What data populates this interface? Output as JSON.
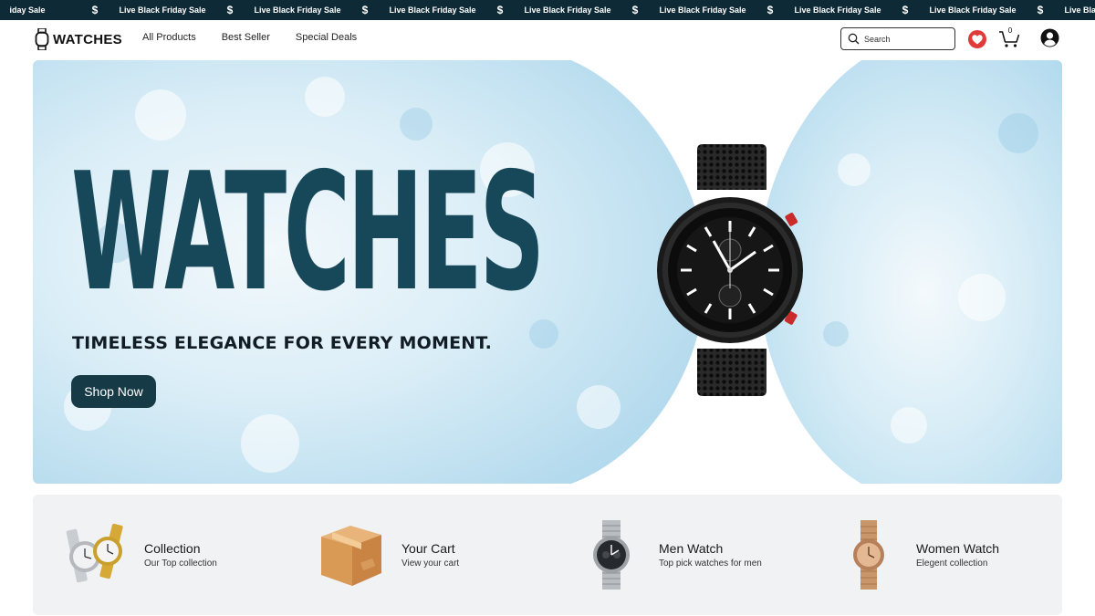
{
  "ticker": {
    "items": [
      "iday Sale",
      "Live Black Friday Sale",
      "Live Black Friday Sale",
      "Live Black Friday Sale",
      "Live Black Friday Sale",
      "Live Black Friday Sale",
      "Live Black Friday Sale",
      "Live Black Friday Sale",
      "Live Black Friday Sale"
    ],
    "separator": "$"
  },
  "header": {
    "logo_text": "WATCHES",
    "nav": [
      "All Products",
      "Best Seller",
      "Special Deals"
    ],
    "search_placeholder": "Search",
    "cart_count": "0",
    "icons": [
      "watch-logo-icon",
      "search-icon",
      "heart-icon",
      "cart-icon",
      "account-icon"
    ]
  },
  "hero": {
    "title": "WATCHES",
    "tagline": "TIMELESS ELEGANCE FOR EVERY MOMENT.",
    "cta_label": "Shop Now"
  },
  "categories": [
    {
      "title": "Collection",
      "subtitle": "Our Top collection",
      "icon": "watch-pair-image"
    },
    {
      "title": "Your Cart",
      "subtitle": "View your cart",
      "icon": "cardboard-box-image"
    },
    {
      "title": "Men Watch",
      "subtitle": "Top pick watches for men",
      "icon": "steel-chronograph-image"
    },
    {
      "title": "Women Watch",
      "subtitle": "Elegent collection",
      "icon": "gold-watch-image"
    }
  ],
  "colors": {
    "ticker_bg": "#0e2a36",
    "title": "#17485a",
    "button": "#163b47",
    "heart": "#e03b3b",
    "panel_bg": "#f0f2f4",
    "hero_sky": "#bfe0f0"
  }
}
